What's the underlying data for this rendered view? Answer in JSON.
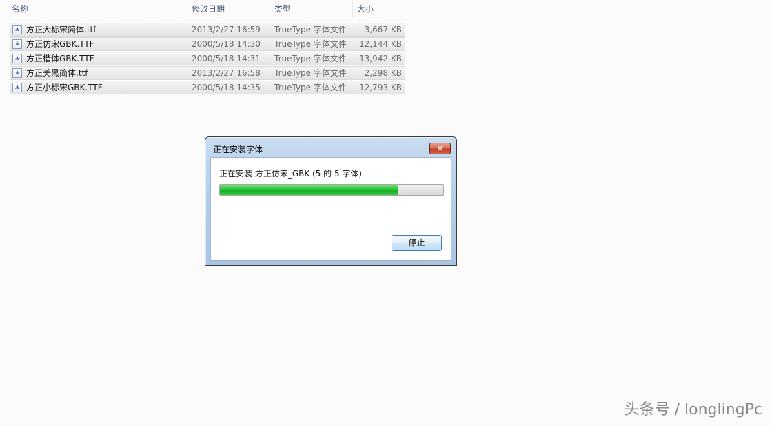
{
  "columns": {
    "name": "名称",
    "date": "修改日期",
    "type": "类型",
    "size": "大小"
  },
  "files": [
    {
      "name": "方正大标宋简体.ttf",
      "date": "2013/2/27 16:59",
      "type": "TrueType 字体文件",
      "size": "3,667 KB",
      "icon": "font-file-icon"
    },
    {
      "name": "方正仿宋GBK.TTF",
      "date": "2000/5/18 14:30",
      "type": "TrueType 字体文件",
      "size": "12,144 KB",
      "icon": "font-file-icon"
    },
    {
      "name": "方正楷体GBK.TTF",
      "date": "2000/5/18 14:31",
      "type": "TrueType 字体文件",
      "size": "13,942 KB",
      "icon": "font-file-icon"
    },
    {
      "name": "方正美黑简体.ttf",
      "date": "2013/2/27 16:58",
      "type": "TrueType 字体文件",
      "size": "2,298 KB",
      "icon": "font-file-icon"
    },
    {
      "name": "方正小标宋GBK.TTF",
      "date": "2000/5/18 14:35",
      "type": "TrueType 字体文件",
      "size": "12,793 KB",
      "icon": "font-file-icon"
    }
  ],
  "dialog": {
    "title": "正在安装字体",
    "status": "正在安装 方正仿宋_GBK (5 的 5 字体)",
    "progress": 0.8,
    "stop_label": "停止",
    "close_glyph": "✕"
  },
  "watermark": "头条号 / longlingPc"
}
